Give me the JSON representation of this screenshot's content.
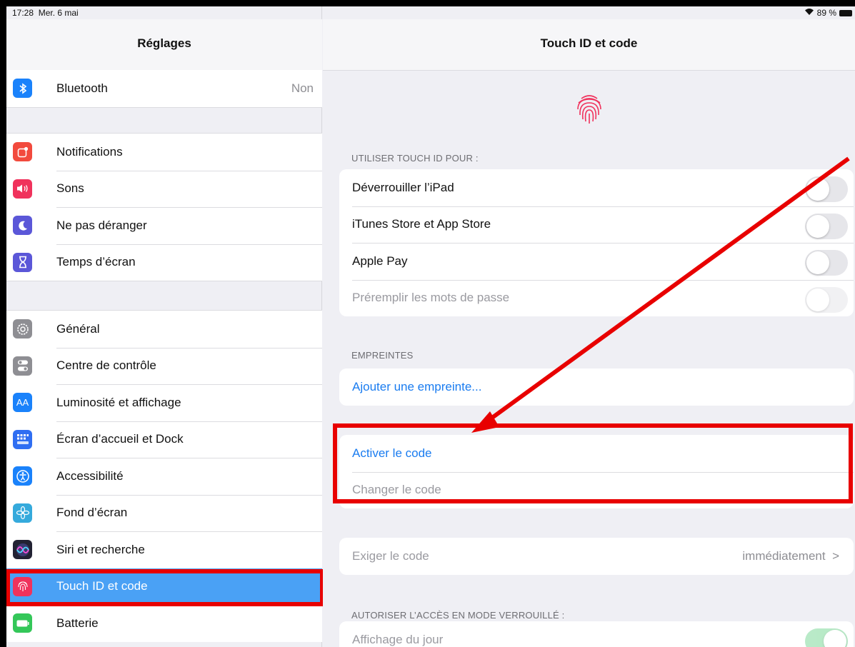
{
  "status": {
    "time": "17:28",
    "date": "Mer. 6 mai",
    "battery": "89 %"
  },
  "sidebar": {
    "title": "Réglages",
    "bluetooth": {
      "label": "Bluetooth",
      "value": "Non",
      "icon": "bluetooth-icon",
      "color": "#1a82fb"
    },
    "group2": [
      {
        "label": "Notifications",
        "icon": "notifications-icon",
        "color": "#f24a3d"
      },
      {
        "label": "Sons",
        "icon": "speaker-icon",
        "color": "#f0325c"
      },
      {
        "label": "Ne pas déranger",
        "icon": "moon-icon",
        "color": "#5b57d8"
      },
      {
        "label": "Temps d’écran",
        "icon": "hourglass-icon",
        "color": "#5b57d8"
      }
    ],
    "group3": [
      {
        "label": "Général",
        "icon": "gear-icon",
        "color": "#8e8e93"
      },
      {
        "label": "Centre de contrôle",
        "icon": "toggles-icon",
        "color": "#8e8e93"
      },
      {
        "label": "Luminosité et affichage",
        "icon": "text-size-icon",
        "glyph": "AA",
        "color": "#1a82fb"
      },
      {
        "label": "Écran d’accueil et Dock",
        "icon": "home-grid-icon",
        "color": "#2f6ef2"
      },
      {
        "label": "Accessibilité",
        "icon": "accessibility-icon",
        "color": "#1a82fb"
      },
      {
        "label": "Fond d’écran",
        "icon": "flower-icon",
        "color": "#35aadc"
      },
      {
        "label": "Siri et recherche",
        "icon": "siri-icon",
        "color": "#222233"
      },
      {
        "label": "Touch ID et code",
        "icon": "fingerprint-icon",
        "color": "#f0325c",
        "selected": true
      },
      {
        "label": "Batterie",
        "icon": "battery-icon",
        "color": "#34c759"
      }
    ]
  },
  "detail": {
    "title": "Touch ID et code",
    "touchid_header": "UTILISER TOUCH ID POUR :",
    "touchid_rows": [
      {
        "label": "Déverrouiller l’iPad"
      },
      {
        "label": "iTunes Store et App Store"
      },
      {
        "label": "Apple Pay"
      },
      {
        "label": "Préremplir les mots de passe",
        "disabled": true
      }
    ],
    "empreintes_header": "EMPREINTES",
    "add_fingerprint": "Ajouter une empreinte...",
    "activate_code": "Activer le code",
    "change_code": "Changer le code",
    "require_code": {
      "label": "Exiger le code",
      "value": "immédiatement",
      "chevron": ">"
    },
    "locked_header": "AUTORISER L’ACCÈS EN MODE VERROUILLÉ :",
    "locked_rows": [
      {
        "label": "Affichage du jour",
        "on": true
      }
    ],
    "annotation_color": "#e80000"
  }
}
